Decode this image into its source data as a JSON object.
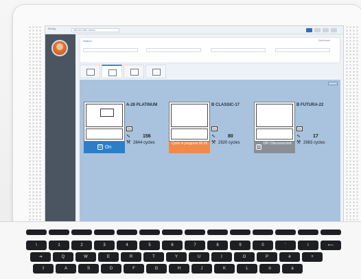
{
  "browser": {
    "logo_text": "Melag",
    "tab_label": "MELAG Web Viewer"
  },
  "header": {
    "search_label": "Search",
    "dashboard_label": "Dashboard"
  },
  "devices": [
    {
      "name": "A-28 PLATINUM",
      "count": "156",
      "cycles": "2844 cycles",
      "status": "On",
      "status_type": "on"
    },
    {
      "name": "B CLASSIC-17",
      "count": "80",
      "cycles": "2920 cycles",
      "status": "Cycle in progress 00:03",
      "status_type": "cycle"
    },
    {
      "name": "B FUTURA-22",
      "count": "17",
      "cycles": "2983 cycles",
      "status": "Off / Disconnected",
      "status_type": "off"
    }
  ],
  "sn_label": "SN",
  "colors": {
    "status_on": "#2c7fc6",
    "status_cycle": "#ef8a4a",
    "status_off": "#8a8f96",
    "panel": "#a9c3de",
    "sidebar": "#4a5561"
  },
  "icons": [
    "power-icon",
    "wave-icon",
    "wrench-icon",
    "sn-badge-icon"
  ],
  "keyboard": {
    "row_numbers": [
      "\\",
      "1",
      "2",
      "3",
      "4",
      "5",
      "6",
      "7",
      "8",
      "9",
      "0",
      "'",
      "ì",
      "⟵"
    ],
    "row_qwerty": [
      "⇥",
      "Q",
      "W",
      "E",
      "R",
      "T",
      "Y",
      "U",
      "I",
      "O",
      "P",
      "è",
      "+"
    ],
    "row_asdf": [
      "⇪",
      "A",
      "S",
      "D",
      "F",
      "G",
      "H",
      "J",
      "K",
      "L",
      "ò",
      "à"
    ]
  }
}
